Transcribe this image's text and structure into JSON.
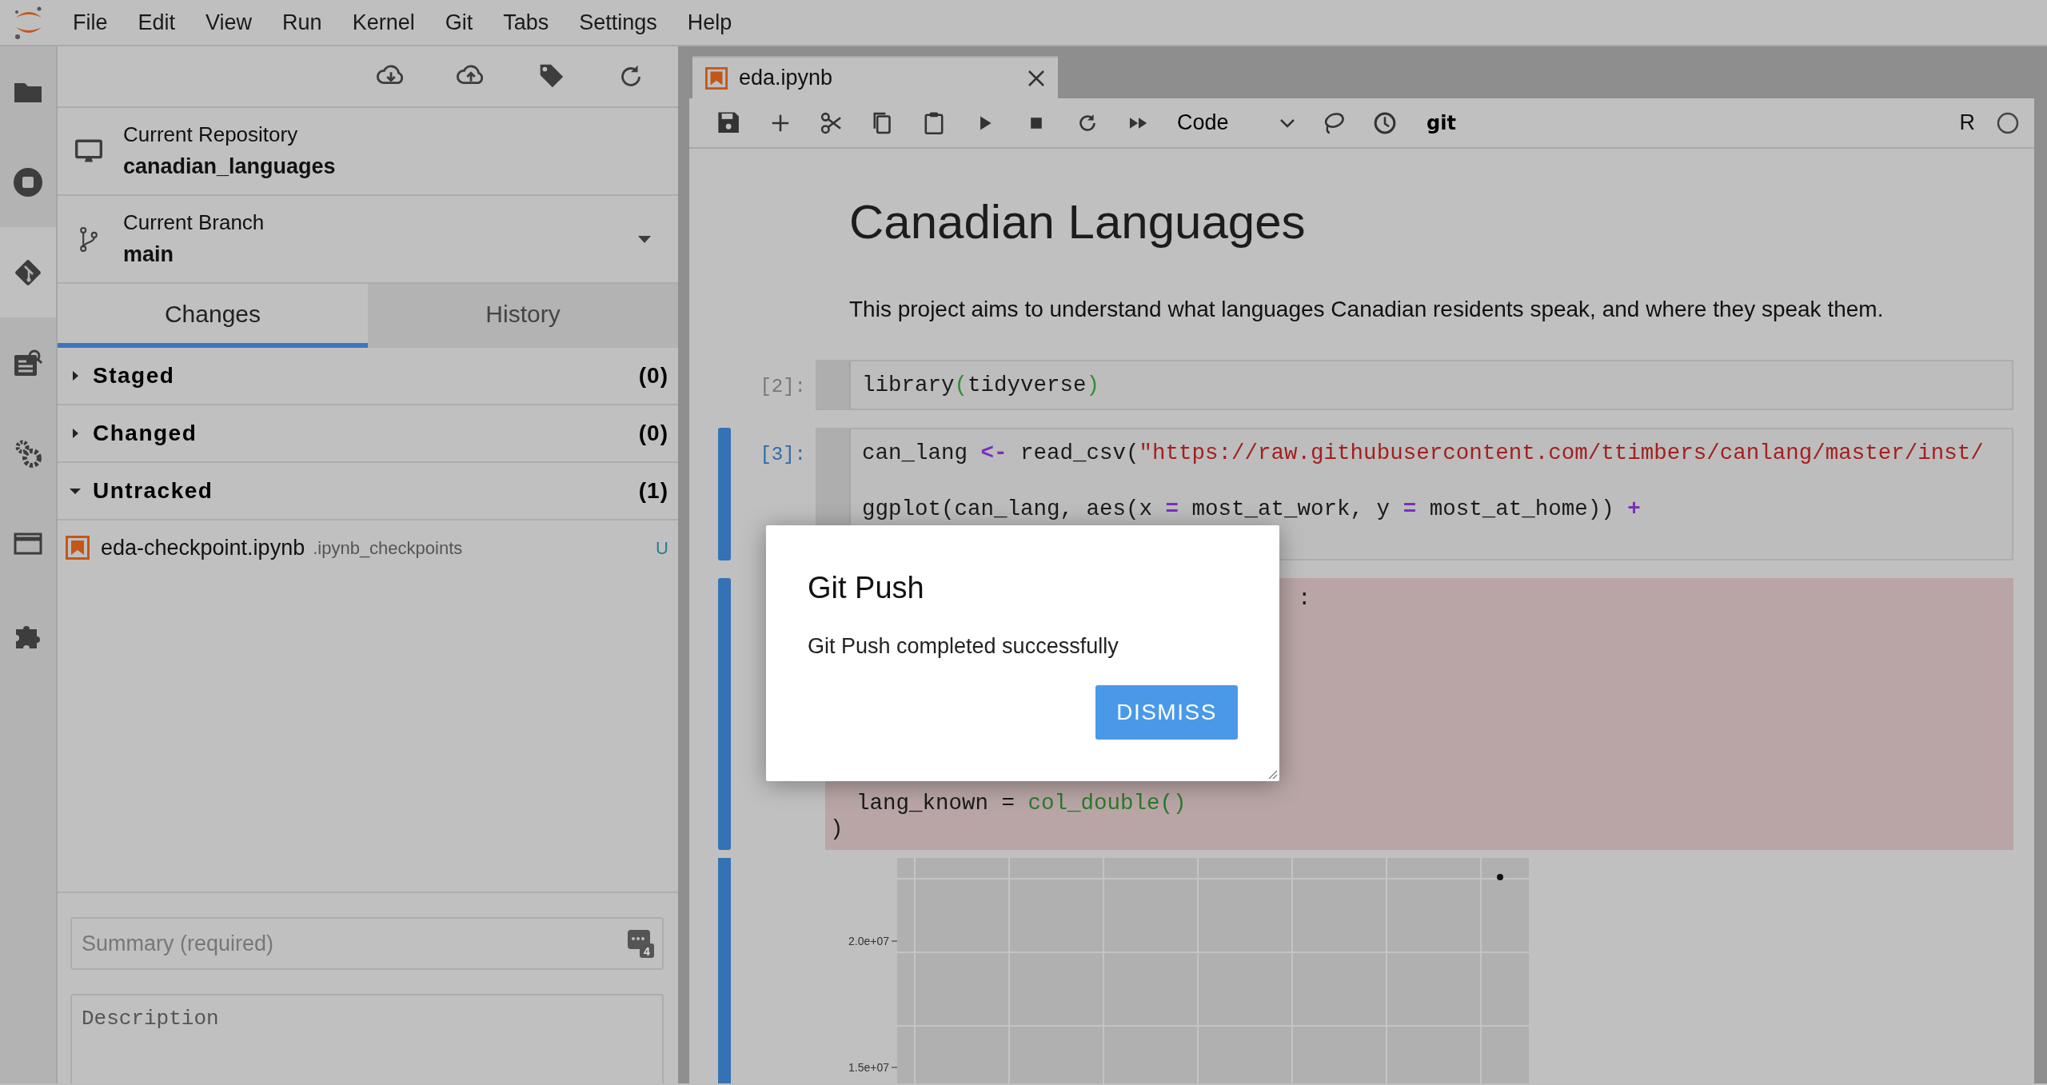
{
  "menu": [
    "File",
    "Edit",
    "View",
    "Run",
    "Kernel",
    "Git",
    "Tabs",
    "Settings",
    "Help"
  ],
  "sidebar": [
    {
      "kind": "folder",
      "selected": false
    },
    {
      "kind": "running",
      "selected": false
    },
    {
      "kind": "git",
      "selected": true
    },
    {
      "kind": "inspector",
      "selected": false
    },
    {
      "kind": "gears",
      "selected": false
    },
    {
      "kind": "window",
      "selected": false
    },
    {
      "kind": "extension",
      "selected": false
    }
  ],
  "git_panel": {
    "repository_label": "Current Repository",
    "repository": "canadian_languages",
    "branch_label": "Current Branch",
    "branch": "main",
    "tabs": [
      {
        "label": "Changes",
        "selected": true
      },
      {
        "label": "History",
        "selected": false
      }
    ],
    "sections": [
      {
        "title": "Staged",
        "count": "(0)",
        "expanded": false
      },
      {
        "title": "Changed",
        "count": "(0)",
        "expanded": false
      },
      {
        "title": "Untracked",
        "count": "(1)",
        "expanded": true,
        "files": [
          {
            "name": "eda-checkpoint.ipynb",
            "path": ".ipynb_checkpoints",
            "status": "U"
          }
        ]
      }
    ],
    "summary": {
      "placeholder": "Summary (required)",
      "badge": "4"
    },
    "description": {
      "placeholder": "Description"
    }
  },
  "notebook": {
    "tab": {
      "title": "eda.ipynb",
      "selected": true
    },
    "cell_type": "Code",
    "toolbar_label": "git",
    "kernel": "R",
    "heading": "Canadian Languages",
    "paragraph": "This project aims to understand what languages Canadian residents speak, and where they speak them.",
    "cells": [
      {
        "prompt": "[2]:",
        "selected": false,
        "lines": [
          {
            "tokens": [
              {
                "text": "library",
                "kind": "plain"
              },
              {
                "text": "(",
                "kind": "bracket"
              },
              {
                "text": "tidyverse",
                "kind": "plain"
              },
              {
                "text": ")",
                "kind": "bracket"
              }
            ]
          }
        ]
      },
      {
        "prompt": "[3]:",
        "selected": true,
        "lines": [
          {
            "tokens": [
              {
                "text": "can_lang ",
                "kind": "plain"
              },
              {
                "text": "<-",
                "kind": "op"
              },
              {
                "text": " read_csv(",
                "kind": "plain"
              },
              {
                "text": "\"https://raw.githubusercontent.com/ttimbers/canlang/master/inst/",
                "kind": "string"
              }
            ]
          },
          {
            "blank_before": true,
            "tokens": [
              {
                "text": "ggplot(can_lang, aes(x ",
                "kind": "plain"
              },
              {
                "text": "=",
                "kind": "op"
              },
              {
                "text": " most_at_work, y ",
                "kind": "plain"
              },
              {
                "text": "=",
                "kind": "op"
              },
              {
                "text": " most_at_home)) ",
                "kind": "plain"
              },
              {
                "text": "+",
                "kind": "op"
              }
            ]
          }
        ]
      }
    ],
    "error_output": {
      "top": [
        {
          "tokens": [
            {
              "text": ":",
              "kind": "plain"
            }
          ]
        }
      ],
      "bottom": [
        {
          "tokens": [
            {
              "text": "  lang_known = ",
              "kind": "plain"
            },
            {
              "text": "col_double()",
              "kind": "func"
            }
          ]
        },
        {
          "tokens": [
            {
              "text": ")",
              "kind": "plain"
            }
          ]
        }
      ]
    },
    "plot": {
      "y_tick_labels": [
        "2.0e+07",
        "1.5e+07"
      ]
    }
  },
  "dialog": {
    "title": "Git Push",
    "message": "Git Push completed successfully",
    "button": "DISMISS"
  }
}
